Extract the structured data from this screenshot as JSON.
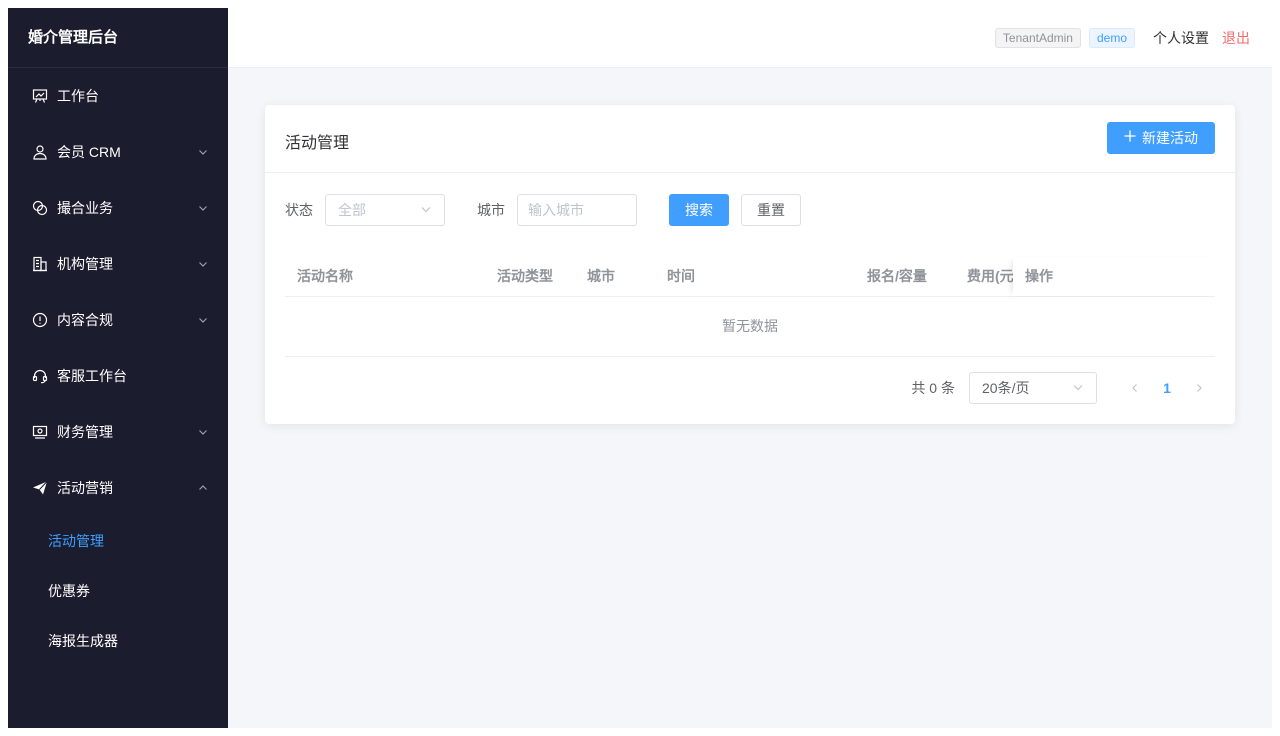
{
  "sidebar": {
    "brand": "婚介管理后台",
    "items": [
      {
        "label": "工作台",
        "icon": "presentation-board-icon",
        "has_arrow": false
      },
      {
        "label": "会员 CRM",
        "icon": "user-icon",
        "has_arrow": true
      },
      {
        "label": "撮合业务",
        "icon": "match-icon",
        "has_arrow": true
      },
      {
        "label": "机构管理",
        "icon": "building-icon",
        "has_arrow": true
      },
      {
        "label": "内容合规",
        "icon": "warning-circle-icon",
        "has_arrow": true
      },
      {
        "label": "客服工作台",
        "icon": "headset-icon",
        "has_arrow": false
      },
      {
        "label": "财务管理",
        "icon": "wallet-icon",
        "has_arrow": true
      },
      {
        "label": "活动营销",
        "icon": "send-icon",
        "has_arrow": true,
        "expanded": true
      }
    ],
    "subitems": [
      {
        "label": "活动管理",
        "active": true
      },
      {
        "label": "优惠券",
        "active": false
      },
      {
        "label": "海报生成器",
        "active": false
      }
    ]
  },
  "header": {
    "tenant_tag": "TenantAdmin",
    "user_tag": "demo",
    "settings": "个人设置",
    "logout": "退出"
  },
  "card": {
    "title": "活动管理",
    "new_button": "新建活动"
  },
  "filters": {
    "status_label": "状态",
    "status_value": "全部",
    "city_label": "城市",
    "city_placeholder": "输入城市",
    "search_button": "搜索",
    "reset_button": "重置"
  },
  "table": {
    "columns": [
      "活动名称",
      "活动类型",
      "城市",
      "时间",
      "报名/容量",
      "费用(元)",
      "操作"
    ],
    "empty_text": "暂无数据"
  },
  "pagination": {
    "total": "共 0 条",
    "page_size": "20条/页",
    "current_page": "1"
  },
  "colors": {
    "sidebar_bg": "#1b1d2e",
    "accent": "#409eff",
    "logout": "#f56c6c"
  }
}
